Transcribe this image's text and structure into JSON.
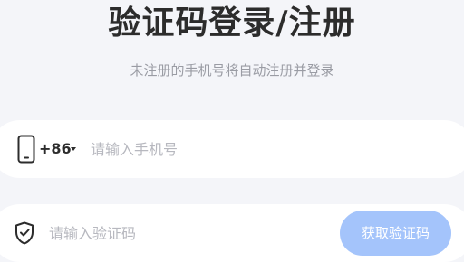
{
  "header": {
    "title": "验证码登录/注册",
    "subtitle": "未注册的手机号将自动注册并登录"
  },
  "phone_field": {
    "icon": "phone-icon",
    "country_code": "+86",
    "dropdown_icon": "caret-down-icon",
    "value": "",
    "placeholder": "请输入手机号"
  },
  "code_field": {
    "icon": "shield-check-icon",
    "value": "",
    "placeholder": "请输入验证码",
    "get_code_label": "获取验证码"
  },
  "colors": {
    "background": "#f4f5f9",
    "field_background": "#ffffff",
    "title_text": "#2c2c2c",
    "subtitle_text": "#9a9ca4",
    "placeholder_text": "#b7b8bf",
    "button_background": "#a4c4fb",
    "button_text": "#ffffff"
  }
}
